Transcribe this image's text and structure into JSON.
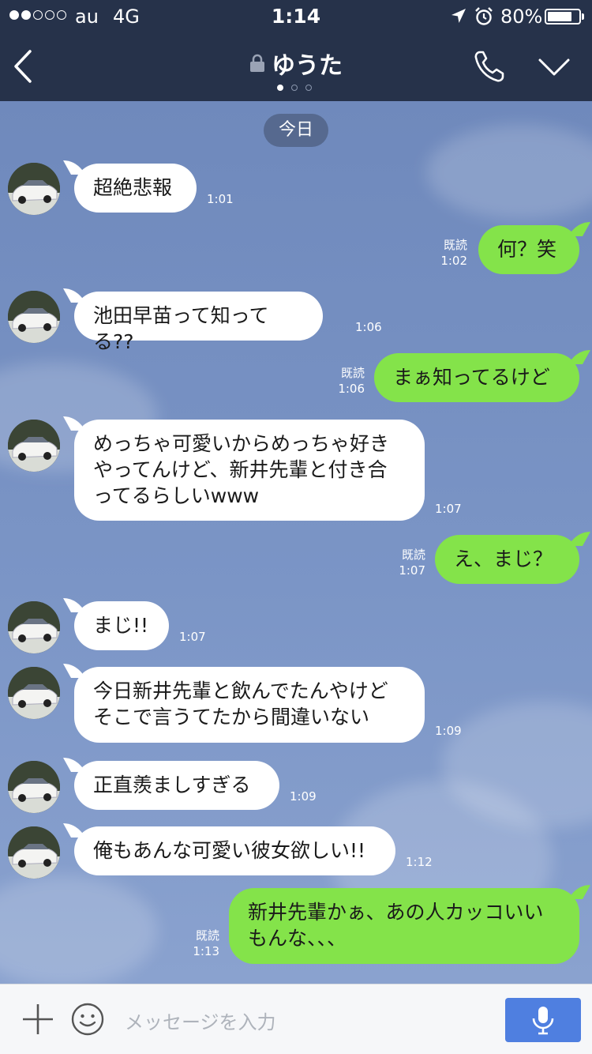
{
  "status_bar": {
    "carrier": "au",
    "network": "4G",
    "time": "1:14",
    "battery_percent": "80%",
    "battery_level": 0.8,
    "signal_bars_filled": 2,
    "signal_bars_total": 5
  },
  "header": {
    "title": "ゆうた",
    "page_count": 3,
    "active_page": 1
  },
  "chat": {
    "date_label": "今日",
    "messages": [
      {
        "side": "in",
        "text": "超絶悲報",
        "time": "1:01"
      },
      {
        "side": "out",
        "text": "何？笑",
        "read": "既読",
        "time": "1:02"
      },
      {
        "side": "in",
        "text": "池田早苗って知ってる??",
        "time": "1:06"
      },
      {
        "side": "out",
        "text": "まぁ知ってるけど",
        "read": "既読",
        "time": "1:06"
      },
      {
        "side": "in",
        "text": "めっちゃ可愛いからめっちゃ好き\nやってんけど、新井先輩と付き合\nってるらしいwww",
        "time": "1:07"
      },
      {
        "side": "out",
        "text": "え、まじ？",
        "read": "既読",
        "time": "1:07"
      },
      {
        "side": "in",
        "text": "まじ!!",
        "time": "1:07"
      },
      {
        "side": "in",
        "text": "今日新井先輩と飲んでたんやけど\nそこで言うてたから間違いない",
        "time": "1:09"
      },
      {
        "side": "in",
        "text": "正直羨ましすぎる",
        "time": "1:09"
      },
      {
        "side": "in",
        "text": "俺もあんな可愛い彼女欲しい!!",
        "time": "1:12"
      },
      {
        "side": "out",
        "text": "新井先輩かぁ、あの人カッコいい\nもんな、、、",
        "read": "既読",
        "time": "1:13"
      }
    ]
  },
  "input": {
    "placeholder": "メッセージを入力"
  },
  "icons": {
    "back": "chevron-left-icon",
    "lock": "lock-icon",
    "call": "phone-icon",
    "menu": "chevron-down-icon",
    "add": "plus-icon",
    "sticker": "smiley-icon",
    "voice": "microphone-icon"
  },
  "colors": {
    "header_bg": "#26324a",
    "chat_bg": "#7b95c6",
    "outgoing_bubble": "#84e34a",
    "incoming_bubble": "#ffffff",
    "send_button": "#4f7fe0"
  }
}
